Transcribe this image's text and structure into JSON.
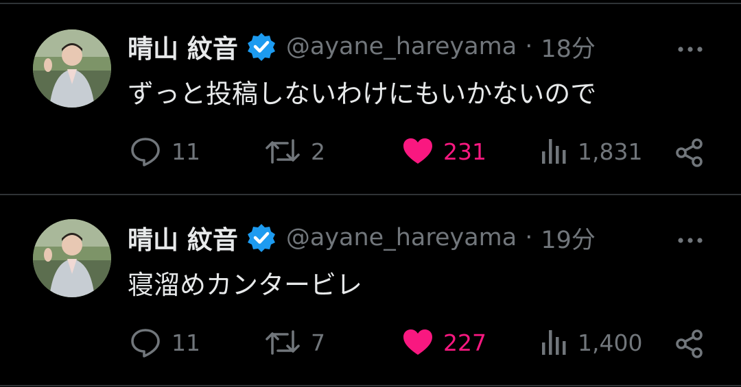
{
  "colors": {
    "accent_like": "#f91880",
    "verified": "#1d9bf0",
    "muted": "#71767b",
    "text": "#e7e9ea",
    "background": "#000000"
  },
  "tweets": [
    {
      "name": "晴山 紋音",
      "handle": "@ayane_hareyama",
      "separator": "·",
      "time": "18分",
      "text": "ずっと投稿しないわけにもいかないので",
      "replies": "11",
      "retweets": "2",
      "likes": "231",
      "views": "1,831",
      "liked": true
    },
    {
      "name": "晴山 紋音",
      "handle": "@ayane_hareyama",
      "separator": "·",
      "time": "19分",
      "text": "寝溜めカンタービレ",
      "replies": "11",
      "retweets": "7",
      "likes": "227",
      "views": "1,400",
      "liked": true
    }
  ],
  "icons": [
    "avatar",
    "verified-badge-icon",
    "more-icon",
    "reply-icon",
    "retweet-icon",
    "like-icon",
    "views-icon",
    "share-icon"
  ]
}
